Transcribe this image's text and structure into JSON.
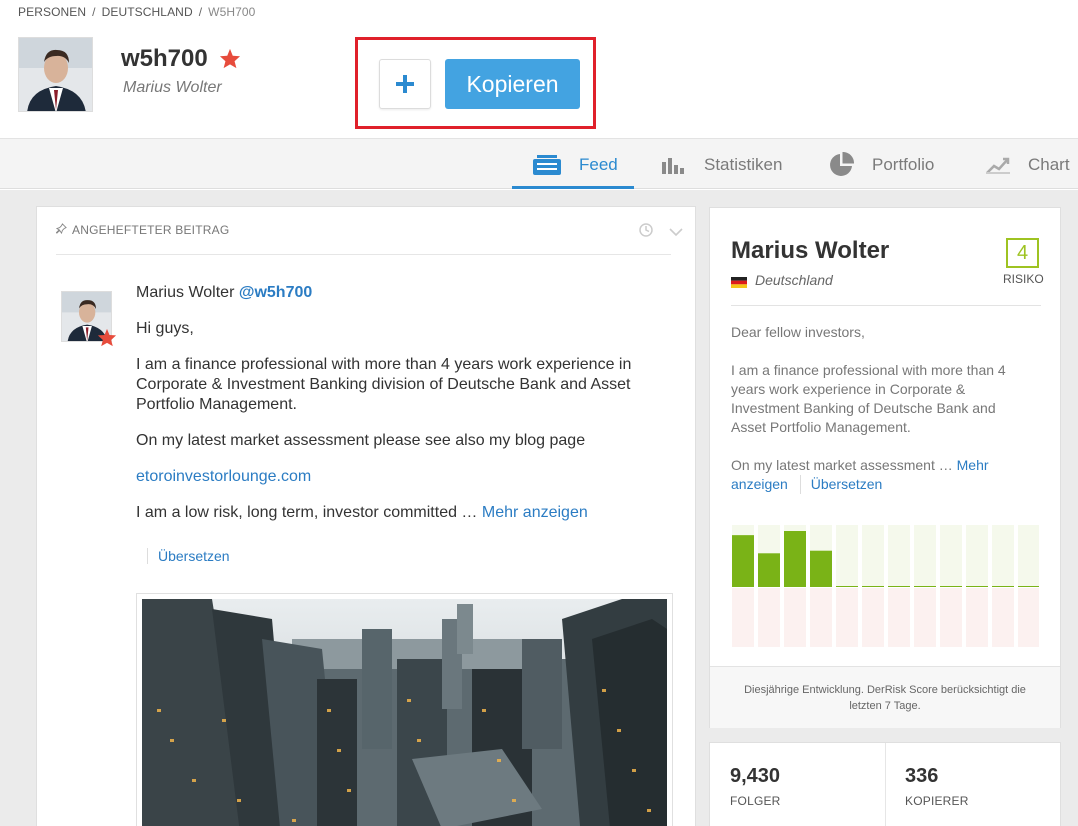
{
  "breadcrumb": {
    "items": [
      "PERSONEN",
      "DEUTSCHLAND",
      "W5H700"
    ]
  },
  "profile_header": {
    "username": "w5h700",
    "real_name": "Marius Wolter",
    "plus_label": "+",
    "copy_label": "Kopieren"
  },
  "tabs": [
    {
      "label": "Feed",
      "icon": "feed-icon",
      "active": true
    },
    {
      "label": "Statistiken",
      "icon": "bar-chart-icon",
      "active": false
    },
    {
      "label": "Portfolio",
      "icon": "pie-chart-icon",
      "active": false
    },
    {
      "label": "Chart",
      "icon": "line-chart-icon",
      "active": false
    }
  ],
  "feed": {
    "pinned_label": "ANGEHEFTETER BEITRAG",
    "post": {
      "author": "Marius Wolter",
      "handle": "@w5h700",
      "greeting": "Hi guys,",
      "paragraph1": "I am a finance professional with more than 4 years work experience in Corporate & Investment Banking division of Deutsche Bank and Asset Portfolio Management.",
      "paragraph2": "On my latest market assessment please see also my blog page",
      "blog_link": "etoroinvestorlounge.com",
      "paragraph3": "I am a low risk, long term, investor committed …",
      "more_link": "Mehr anzeigen",
      "translate_link": "Übersetzen"
    }
  },
  "profile_card": {
    "name": "Marius Wolter",
    "country": "Deutschland",
    "risk_score": "4",
    "risk_label": "RISIKO",
    "bio_greeting": "Dear fellow investors,",
    "bio_text": "I am a finance professional with more than 4 years work experience in Corporate & Investment Banking of Deutsche Bank and Asset Portfolio Management.",
    "bio_more_prefix": "On my latest market assessment …",
    "bio_more_link": "Mehr anzeigen",
    "bio_translate": "Übersetzen",
    "footer_note": "Diesjährige Entwicklung. DerRisk Score berücksichtigt die letzten 7 Tage.",
    "monthly_bars": [
      1,
      0.65,
      1.08,
      0.7,
      0,
      0,
      0,
      0,
      0,
      0,
      0,
      0
    ],
    "colors": {
      "positive": "#7ab317",
      "positive_bg": "#f5f9ec",
      "negative_bg": "#fcf1f0",
      "risk": "#9ec321"
    }
  },
  "stats": {
    "followers_value": "9,430",
    "followers_label": "FOLGER",
    "copiers_value": "336",
    "copiers_label": "KOPIERER"
  },
  "accent_color": "#2b8ad0"
}
